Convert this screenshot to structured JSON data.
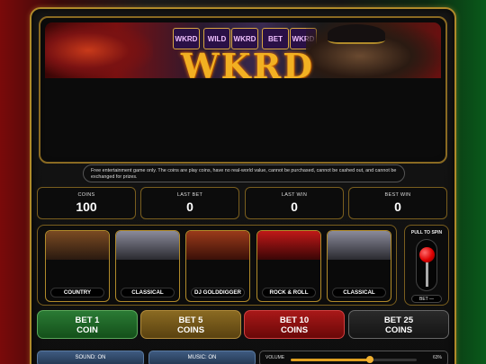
{
  "banner": {
    "logo_text": "WKRD",
    "reel_labels": [
      "WKRD",
      "WILD",
      "WKRD",
      "BET",
      "WKRD"
    ]
  },
  "notice": "Free entertainment game only. The coins are play coins, have no real-world value, cannot be purchased, cannot be cashed out, and cannot be exchanged for prizes.",
  "stats": [
    {
      "label": "COINS",
      "value": "100"
    },
    {
      "label": "LAST BET",
      "value": "0"
    },
    {
      "label": "LAST WIN",
      "value": "0"
    },
    {
      "label": "BEST WIN",
      "value": "0"
    }
  ],
  "music_cards": [
    {
      "name": "COUNTRY",
      "art_color": "#7a4a22"
    },
    {
      "name": "CLASSICAL",
      "art_color": "#6a6a7a"
    },
    {
      "name": "DJ GOLDDIGGER",
      "art_color": "#8a2a1a"
    },
    {
      "name": "ROCK & ROLL",
      "art_color": "#a01818"
    },
    {
      "name": "CLASSICAL",
      "art_color": "#6a6a7a"
    }
  ],
  "lever": {
    "title": "PULL TO SPIN",
    "bet_display": "BET —"
  },
  "bet_buttons": [
    {
      "line1": "BET 1",
      "line2": "COIN"
    },
    {
      "line1": "BET 5",
      "line2": "COINS"
    },
    {
      "line1": "BET 10",
      "line2": "COINS"
    },
    {
      "line1": "BET 25",
      "line2": "COINS"
    }
  ],
  "controls": {
    "sound": "SOUND: ON",
    "music": "MUSIC: ON",
    "volume_label": "VOLUME",
    "volume_percent": "63%",
    "volume_level": 0.63
  },
  "colors": {
    "gold_accent": "#b08a2a",
    "lever_knob": "#d00000"
  }
}
